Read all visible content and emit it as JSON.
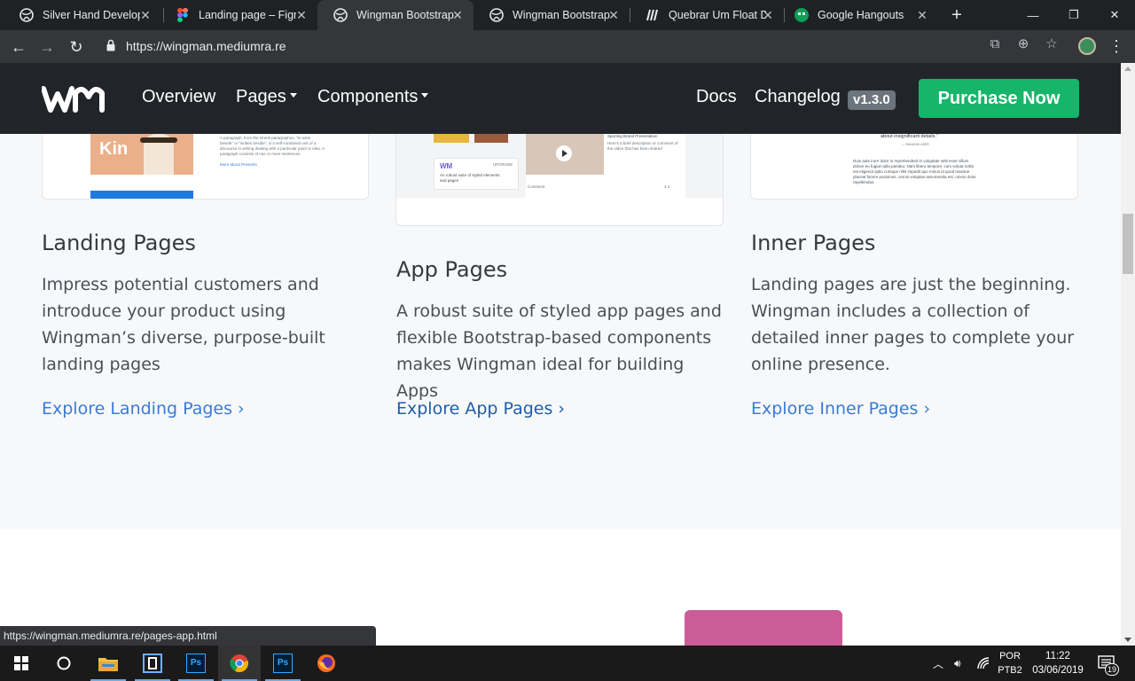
{
  "browser": {
    "tabs": [
      {
        "title": "Silver Hand Develop",
        "icon": "globe-icon",
        "active": false
      },
      {
        "title": "Landing page – Figm",
        "icon": "figma-icon",
        "active": false
      },
      {
        "title": "Wingman Bootstrap",
        "icon": "globe-icon",
        "active": true
      },
      {
        "title": "Wingman Bootstrap",
        "icon": "globe-icon",
        "active": false
      },
      {
        "title": "Quebrar Um Float De",
        "icon": "stripe-icon",
        "active": false
      },
      {
        "title": "Google Hangouts",
        "icon": "hangouts-icon",
        "active": false
      }
    ],
    "url": "https://wingman.mediumra.re",
    "status_url": "https://wingman.mediumra.re/pages-app.html"
  },
  "site": {
    "brand": "Wingman logo",
    "nav": {
      "overview": "Overview",
      "pages": "Pages",
      "components": "Components",
      "docs": "Docs",
      "changelog": "Changelog",
      "version": "v1.3.0",
      "purchase": "Purchase Now"
    },
    "previews": {
      "landing": {
        "brand_text": "Kin",
        "para": "A paragraph, from the Greek paragraphos, \"to write beside\" or \"written beside\", is a self-contained unit of a discourse in writing dealing with a particular point or idea. A paragraph consists of one or more sentences.",
        "link": "More about Presents"
      },
      "app": {
        "card_text": "An robust suite of styled elements and pages",
        "card_tag": "UPGRADE",
        "caption": "Here's a brief description or comment of the video that has been shared",
        "heading": "Sporting Brand Presentation",
        "footer_left": "Comment",
        "footer_right": "4  2"
      },
      "inner": {
        "quote": "about insignificant details.\"",
        "attribution": "— RANDOM USER",
        "para": "Duis aute irure dolor in reprehenderit in voluptate velit esse cillum dolore eu fugiat nulla pariatur. Nam libero tempore, cum soluta nobis est eligendi optio cumque nihil impedit quo minus id quod maxime placeat facere possimus, omnis voluptas assumenda est, omnis dolor repellendus."
      }
    },
    "features": [
      {
        "title": "Landing Pages",
        "desc": "Impress potential customers and introduce your product using Wingman’s diverse, purpose-built landing pages",
        "link": "Explore Landing Pages ›"
      },
      {
        "title": "App Pages",
        "desc": "A robust suite of styled app pages and flexible Bootstrap-based components makes Wingman ideal for building Apps",
        "link": "Explore App Pages ›"
      },
      {
        "title": "Inner Pages",
        "desc": "Landing pages are just the beginning. Wingman includes a collection of detailed inner pages to complete your online presence.",
        "link": "Explore Inner Pages ›"
      }
    ]
  },
  "taskbar": {
    "lang_1": "POR",
    "lang_2": "PTB2",
    "time": "11:22",
    "date": "03/06/2019",
    "notifications": "19"
  },
  "colors": {
    "nav_bg": "#212529",
    "purchase": "#17b56a",
    "link": "#3a7bd5",
    "pink": "#cc5c98"
  }
}
